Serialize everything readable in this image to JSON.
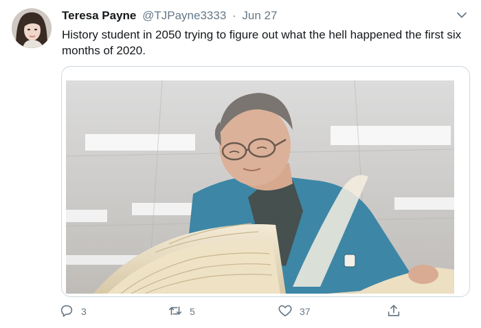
{
  "tweet": {
    "author_name": "Teresa Payne",
    "handle": "@TJPayne3333",
    "separator": "·",
    "date": "Jun 27",
    "text": "History student in 2050 trying to figure out what the hell happened the first six months of 2020."
  },
  "icons": {
    "menu": "chevron-down-icon",
    "reply": "reply-icon",
    "retweet": "retweet-icon",
    "like": "heart-icon",
    "share": "share-icon"
  },
  "actions": {
    "reply_count": "3",
    "retweet_count": "5",
    "like_count": "37"
  },
  "colors": {
    "text": "#14171a",
    "muted": "#657786",
    "border": "#ccd6dd"
  }
}
